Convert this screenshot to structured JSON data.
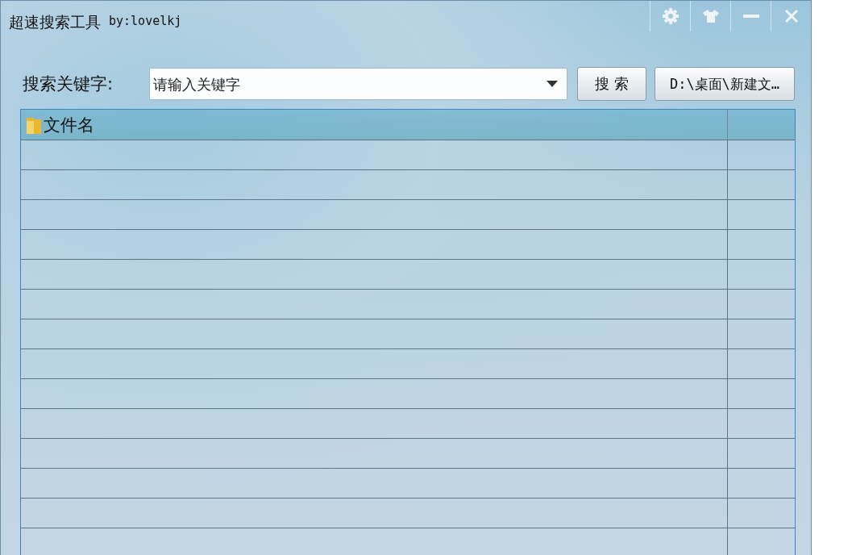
{
  "window": {
    "title": "超速搜索工具",
    "author": "by:lovelkj"
  },
  "search": {
    "label": "搜索关键字:",
    "placeholder": "请输入关键字"
  },
  "buttons": {
    "search": "搜 索",
    "path": "D:\\桌面\\新建文…"
  },
  "table": {
    "columns": [
      "文件名"
    ]
  }
}
